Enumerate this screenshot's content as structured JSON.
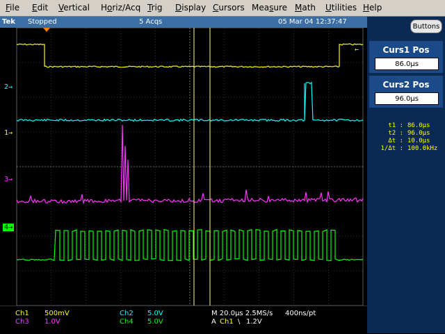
{
  "menu": {
    "items": [
      "File",
      "Edit",
      "Vertical",
      "Horiz/Acq",
      "Trig",
      "Display",
      "Cursors",
      "Measure",
      "Math",
      "Utilities",
      "Help"
    ],
    "underline_chars": [
      "F",
      "E",
      "V",
      "o",
      "T",
      "D",
      "C",
      "s",
      "M",
      "U",
      "H"
    ]
  },
  "status": {
    "brand": "Tek",
    "run_state": "Stopped",
    "acquisitions": "5 Acqs",
    "datetime": "05 Mar 04 12:37:47"
  },
  "channels": {
    "markers": [
      {
        "label": "2",
        "color": "#00ffff"
      },
      {
        "label": "1",
        "color": "#ffff00"
      },
      {
        "label": "3",
        "color": "#ff33ff"
      },
      {
        "label": "4",
        "color": "#00ff00"
      }
    ]
  },
  "readout": {
    "ch1": {
      "label": "Ch1",
      "scale": "500mV",
      "color": "#ffff00"
    },
    "ch2": {
      "label": "Ch2",
      "scale": "5.0V",
      "color": "#00ffff"
    },
    "ch3": {
      "label": "Ch3",
      "scale": "1.0V",
      "color": "#ff33ff"
    },
    "ch4": {
      "label": "Ch4",
      "scale": "5.0V",
      "color": "#00ff00"
    },
    "timebase": "M 20.0µs 2.5MS/s",
    "record": "400ns/pt",
    "trigger_prefix": "A",
    "trigger_source": "Ch1",
    "trigger_slope_symbol": "\\",
    "trigger_level": "1.2V"
  },
  "panel": {
    "buttons_label": "Buttons",
    "curs1_title": "Curs1 Pos",
    "curs1_value": "86.0µs",
    "curs2_title": "Curs2 Pos",
    "curs2_value": "96.0µs"
  },
  "cursor_readout": [
    {
      "label": "t1 :",
      "value": "86.0µs"
    },
    {
      "label": "t2 :",
      "value": "96.0µs"
    },
    {
      "label": "Δt :",
      "value": "10.0µs"
    },
    {
      "label": "1/Δt :",
      "value": "100.0kHz"
    }
  ],
  "colors": {
    "ch1": "#ffff00",
    "ch2": "#00ffff",
    "ch3": "#ff33ff",
    "ch4": "#00ff00",
    "cursor": "#ffff80",
    "grid": "#5a5a5a",
    "panel_bg": "#0a2a55"
  }
}
